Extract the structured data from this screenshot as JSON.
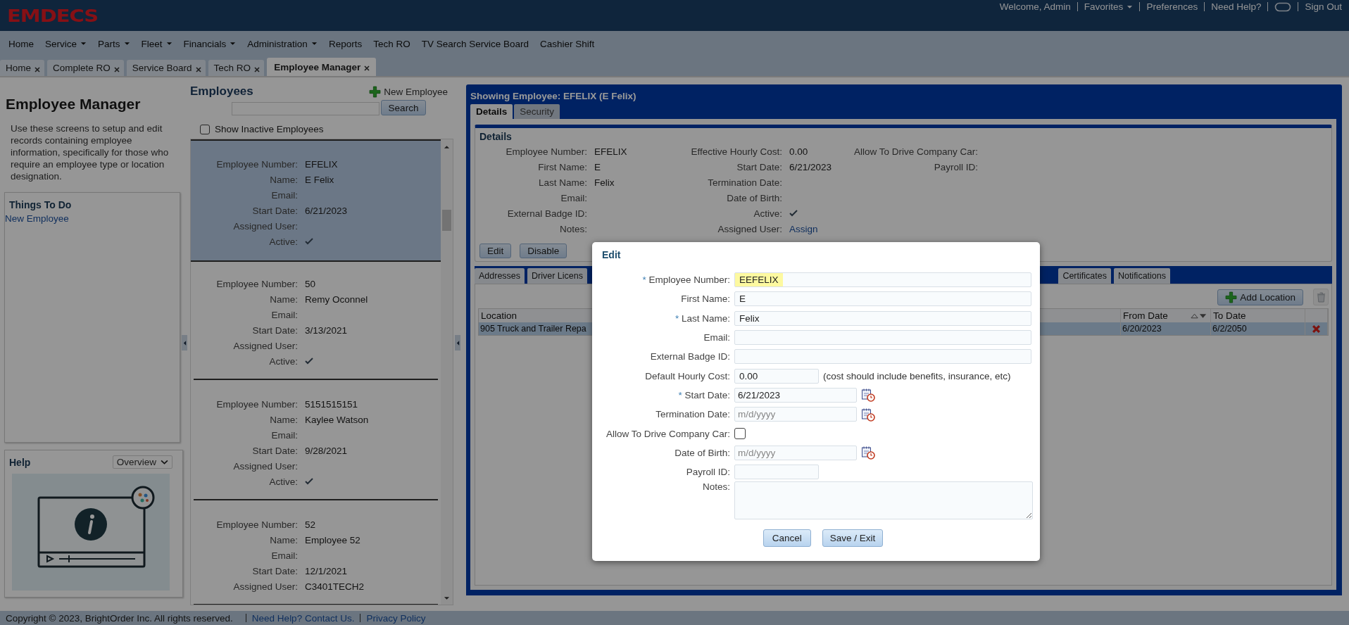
{
  "header": {
    "logo": "EMDECS",
    "links": [
      {
        "label": "Welcome, Admin",
        "kind": "text"
      },
      {
        "label": "Favorites",
        "kind": "dropdown"
      },
      {
        "label": "Preferences",
        "kind": "link"
      },
      {
        "label": "Need Help?",
        "kind": "link"
      },
      {
        "kind": "icon"
      },
      {
        "label": "Sign Out",
        "kind": "link"
      }
    ]
  },
  "nav_menu": [
    {
      "label": "Home",
      "has_dropdown": false
    },
    {
      "label": "Service",
      "has_dropdown": true
    },
    {
      "label": "Parts",
      "has_dropdown": true
    },
    {
      "label": "Fleet",
      "has_dropdown": true
    },
    {
      "label": "Financials",
      "has_dropdown": true
    },
    {
      "label": "Administration",
      "has_dropdown": true
    },
    {
      "label": "Reports",
      "has_dropdown": false
    },
    {
      "label": "Tech RO",
      "has_dropdown": false
    },
    {
      "label": "TV Search Service Board",
      "has_dropdown": false
    },
    {
      "label": "Cashier Shift",
      "has_dropdown": false
    }
  ],
  "tabs": [
    {
      "label": "Home",
      "selected": false
    },
    {
      "label": "Complete RO",
      "selected": false
    },
    {
      "label": "Service Board",
      "selected": false
    },
    {
      "label": "Tech RO",
      "selected": false
    },
    {
      "label": "Employee Manager",
      "selected": true
    }
  ],
  "sidebar": {
    "title": "Employee Manager",
    "description": "Use these screens to setup and edit records containing employee information, specifically for those who require an employee type or location designation.",
    "things_to_do": {
      "title": "Things To Do",
      "links": [
        "New Employee"
      ]
    },
    "help": {
      "title": "Help",
      "dropdown": "Overview"
    }
  },
  "employees": {
    "title": "Employees",
    "new_button": "New Employee",
    "search_button": "Search",
    "show_inactive": {
      "label": "Show Inactive Employees",
      "checked": false
    },
    "cards": [
      {
        "selected": true,
        "rows": [
          {
            "label": "Employee Number:",
            "kind": "text",
            "value": "EFELIX"
          },
          {
            "label": "Name:",
            "kind": "text",
            "value": "E Felix"
          },
          {
            "label": "Email:",
            "kind": "text"
          },
          {
            "label": "Start Date:",
            "kind": "text",
            "value": "6/21/2023"
          },
          {
            "label": "Assigned User:",
            "kind": "text"
          },
          {
            "label": "Active:",
            "kind": "check",
            "checked": true
          }
        ]
      },
      {
        "selected": false,
        "rows": [
          {
            "label": "Employee Number:",
            "kind": "text",
            "value": "50"
          },
          {
            "label": "Name:",
            "kind": "text",
            "value": "Remy Oconnel"
          },
          {
            "label": "Email:",
            "kind": "text"
          },
          {
            "label": "Start Date:",
            "kind": "text",
            "value": "3/13/2021"
          },
          {
            "label": "Assigned User:",
            "kind": "text"
          },
          {
            "label": "Active:",
            "kind": "check",
            "checked": true
          }
        ]
      },
      {
        "selected": false,
        "rows": [
          {
            "label": "Employee Number:",
            "kind": "text",
            "value": "5151515151"
          },
          {
            "label": "Name:",
            "kind": "text",
            "value": "Kaylee Watson"
          },
          {
            "label": "Email:",
            "kind": "text"
          },
          {
            "label": "Start Date:",
            "kind": "text",
            "value": "9/28/2021"
          },
          {
            "label": "Assigned User:",
            "kind": "text"
          },
          {
            "label": "Active:",
            "kind": "check",
            "checked": true
          }
        ]
      },
      {
        "selected": false,
        "rows": [
          {
            "label": "Employee Number:",
            "kind": "text",
            "value": "52"
          },
          {
            "label": "Name:",
            "kind": "text",
            "value": "Employee 52"
          },
          {
            "label": "Email:",
            "kind": "text"
          },
          {
            "label": "Start Date:",
            "kind": "text",
            "value": "12/1/2021"
          },
          {
            "label": "Assigned User:",
            "kind": "text",
            "value": "C3401TECH2"
          }
        ]
      }
    ]
  },
  "employee_panel": {
    "title": "Showing Employee: EFELIX (E Felix)",
    "tabs": [
      {
        "label": "Details",
        "selected": true
      },
      {
        "label": "Security",
        "selected": false
      }
    ],
    "details": {
      "title": "Details",
      "columns": [
        [
          {
            "label": "Employee Number:",
            "kind": "text",
            "value": "EFELIX"
          },
          {
            "label": "First Name:",
            "kind": "text",
            "value": "E"
          },
          {
            "label": "Last Name:",
            "kind": "text",
            "value": "Felix"
          },
          {
            "label": "Email:",
            "kind": "text"
          },
          {
            "label": "External Badge ID:",
            "kind": "text"
          },
          {
            "label": "Notes:",
            "kind": "text"
          }
        ],
        [
          {
            "label": "Effective Hourly Cost:",
            "kind": "text",
            "value": "0.00"
          },
          {
            "label": "Start Date:",
            "kind": "text",
            "value": "6/21/2023"
          },
          {
            "label": "Termination Date:",
            "kind": "text"
          },
          {
            "label": "Date of Birth:",
            "kind": "text"
          },
          {
            "label": "Active:",
            "kind": "check",
            "checked": true
          },
          {
            "label": "Assigned User:",
            "kind": "link",
            "value": "Assign"
          }
        ],
        [
          {
            "label": "Allow To Drive Company Car:",
            "kind": "text"
          },
          {
            "label": "Payroll ID:",
            "kind": "text"
          }
        ]
      ]
    },
    "buttons": [
      "Edit",
      "Disable"
    ],
    "subtabs": [
      "Addresses",
      "Driver Licens",
      "Certificates",
      "Notifications"
    ],
    "add_button": "Add Location",
    "table": {
      "columns": [
        "Location",
        "From Date",
        "To Date"
      ],
      "rows": [
        {
          "location": "905 Truck and Trailer Repa",
          "from_date": "6/20/2023",
          "to_date": "6/2/2050",
          "selected": true
        }
      ]
    }
  },
  "modal": {
    "title": "Edit",
    "fields": [
      {
        "label": "Employee Number:",
        "marker": "*",
        "kind": "text",
        "value": "EEFELIX",
        "highlighted": true
      },
      {
        "label": "First Name:",
        "kind": "text",
        "value": "E",
        "highlighted": false
      },
      {
        "label": "Last Name:",
        "marker": "*",
        "kind": "text",
        "value": "Felix",
        "highlighted": false
      },
      {
        "label": "Email:",
        "kind": "text"
      },
      {
        "label": "External Badge ID:",
        "kind": "text"
      },
      {
        "label": "Default Hourly Cost:",
        "kind": "short",
        "value": "0.00",
        "note": "(cost should include benefits, insurance, etc)",
        "highlighted": false
      },
      {
        "label": "Start Date:",
        "marker": "*",
        "kind": "date",
        "value": "6/21/2023"
      },
      {
        "label": "Termination Date:",
        "kind": "date",
        "placeholder": "m/d/yyyy"
      },
      {
        "label": "Allow To Drive Company Car:",
        "kind": "checkbox",
        "checked": false
      },
      {
        "label": "Date of Birth:",
        "kind": "date",
        "placeholder": "m/d/yyyy"
      },
      {
        "label": "Payroll ID:",
        "kind": "short"
      },
      {
        "label": "Notes:",
        "kind": "textarea"
      }
    ],
    "buttons": [
      "Cancel",
      "Save / Exit"
    ]
  },
  "footer": {
    "copyright": "Copyright © 2023, BrightOrder Inc. All rights reserved.",
    "links": [
      "Need Help? Contact Us.",
      "Privacy Policy"
    ]
  }
}
